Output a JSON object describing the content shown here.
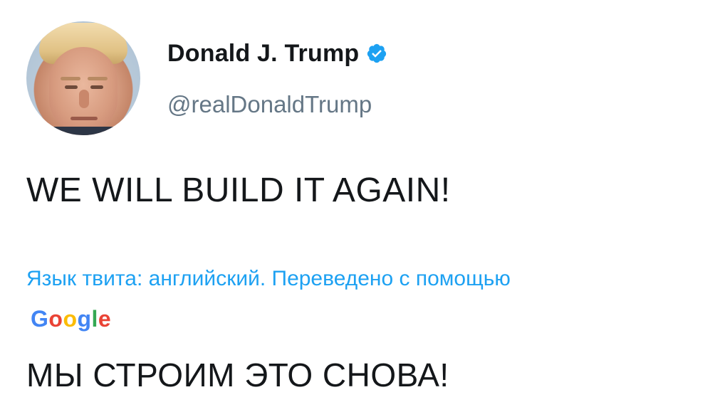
{
  "author": {
    "display_name": "Donald J. Trump",
    "handle": "@realDonaldTrump",
    "verified": true,
    "verified_icon": "verified-badge-icon",
    "avatar": "profile-photo"
  },
  "tweet": {
    "text": "WE WILL BUILD IT AGAIN!"
  },
  "translation": {
    "note": "Язык твита: английский. Переведено с помощью",
    "provider_letters": [
      "G",
      "o",
      "o",
      "g",
      "l",
      "e"
    ],
    "text": "МЫ СТРОИМ ЭТО СНОВА!"
  },
  "colors": {
    "link_blue": "#1da1f2",
    "handle_gray": "#657786",
    "text_dark": "#14171a",
    "verified_blue": "#1da1f2",
    "google_blue": "#4285f4",
    "google_red": "#ea4335",
    "google_yellow": "#fbbc05",
    "google_green": "#34a853"
  }
}
